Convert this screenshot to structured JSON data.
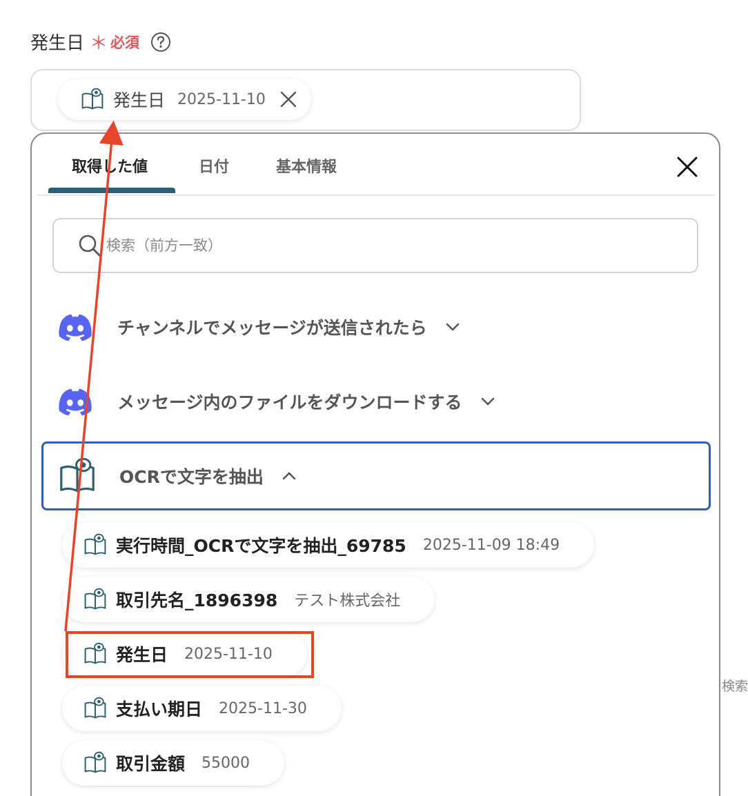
{
  "field": {
    "label": "発生日",
    "required_mark": "＊",
    "required_text": "必須"
  },
  "selected_value": {
    "label": "発生日",
    "value": "2025-11-10"
  },
  "tabs": [
    {
      "label": "取得した値",
      "active": true
    },
    {
      "label": "日付",
      "active": false
    },
    {
      "label": "基本情報",
      "active": false
    }
  ],
  "search": {
    "placeholder": "検索（前方一致）"
  },
  "groups": [
    {
      "title": "チャンネルでメッセージが送信されたら",
      "icon": "discord-icon",
      "expanded": false
    },
    {
      "title": "メッセージ内のファイルをダウンロードする",
      "icon": "discord-icon",
      "expanded": false
    },
    {
      "title": "OCRで文字を抽出",
      "icon": "ocr-book-icon",
      "expanded": true
    }
  ],
  "items": [
    {
      "label": "実行時間_OCRで文字を抽出_69785",
      "value": "2025-11-09 18:49"
    },
    {
      "label": "取引先名_1896398",
      "value": "テスト株式会社"
    },
    {
      "label": "発生日",
      "value": "2025-11-10"
    },
    {
      "label": "支払い期日",
      "value": "2025-11-30"
    },
    {
      "label": "取引金額",
      "value": "55000"
    }
  ],
  "side_text": "検索",
  "colors": {
    "accent": "#2e5f70",
    "required": "#e05555",
    "discord": "#5865f2",
    "active_border": "#2d5fb8",
    "annotation": "#e8432b"
  }
}
